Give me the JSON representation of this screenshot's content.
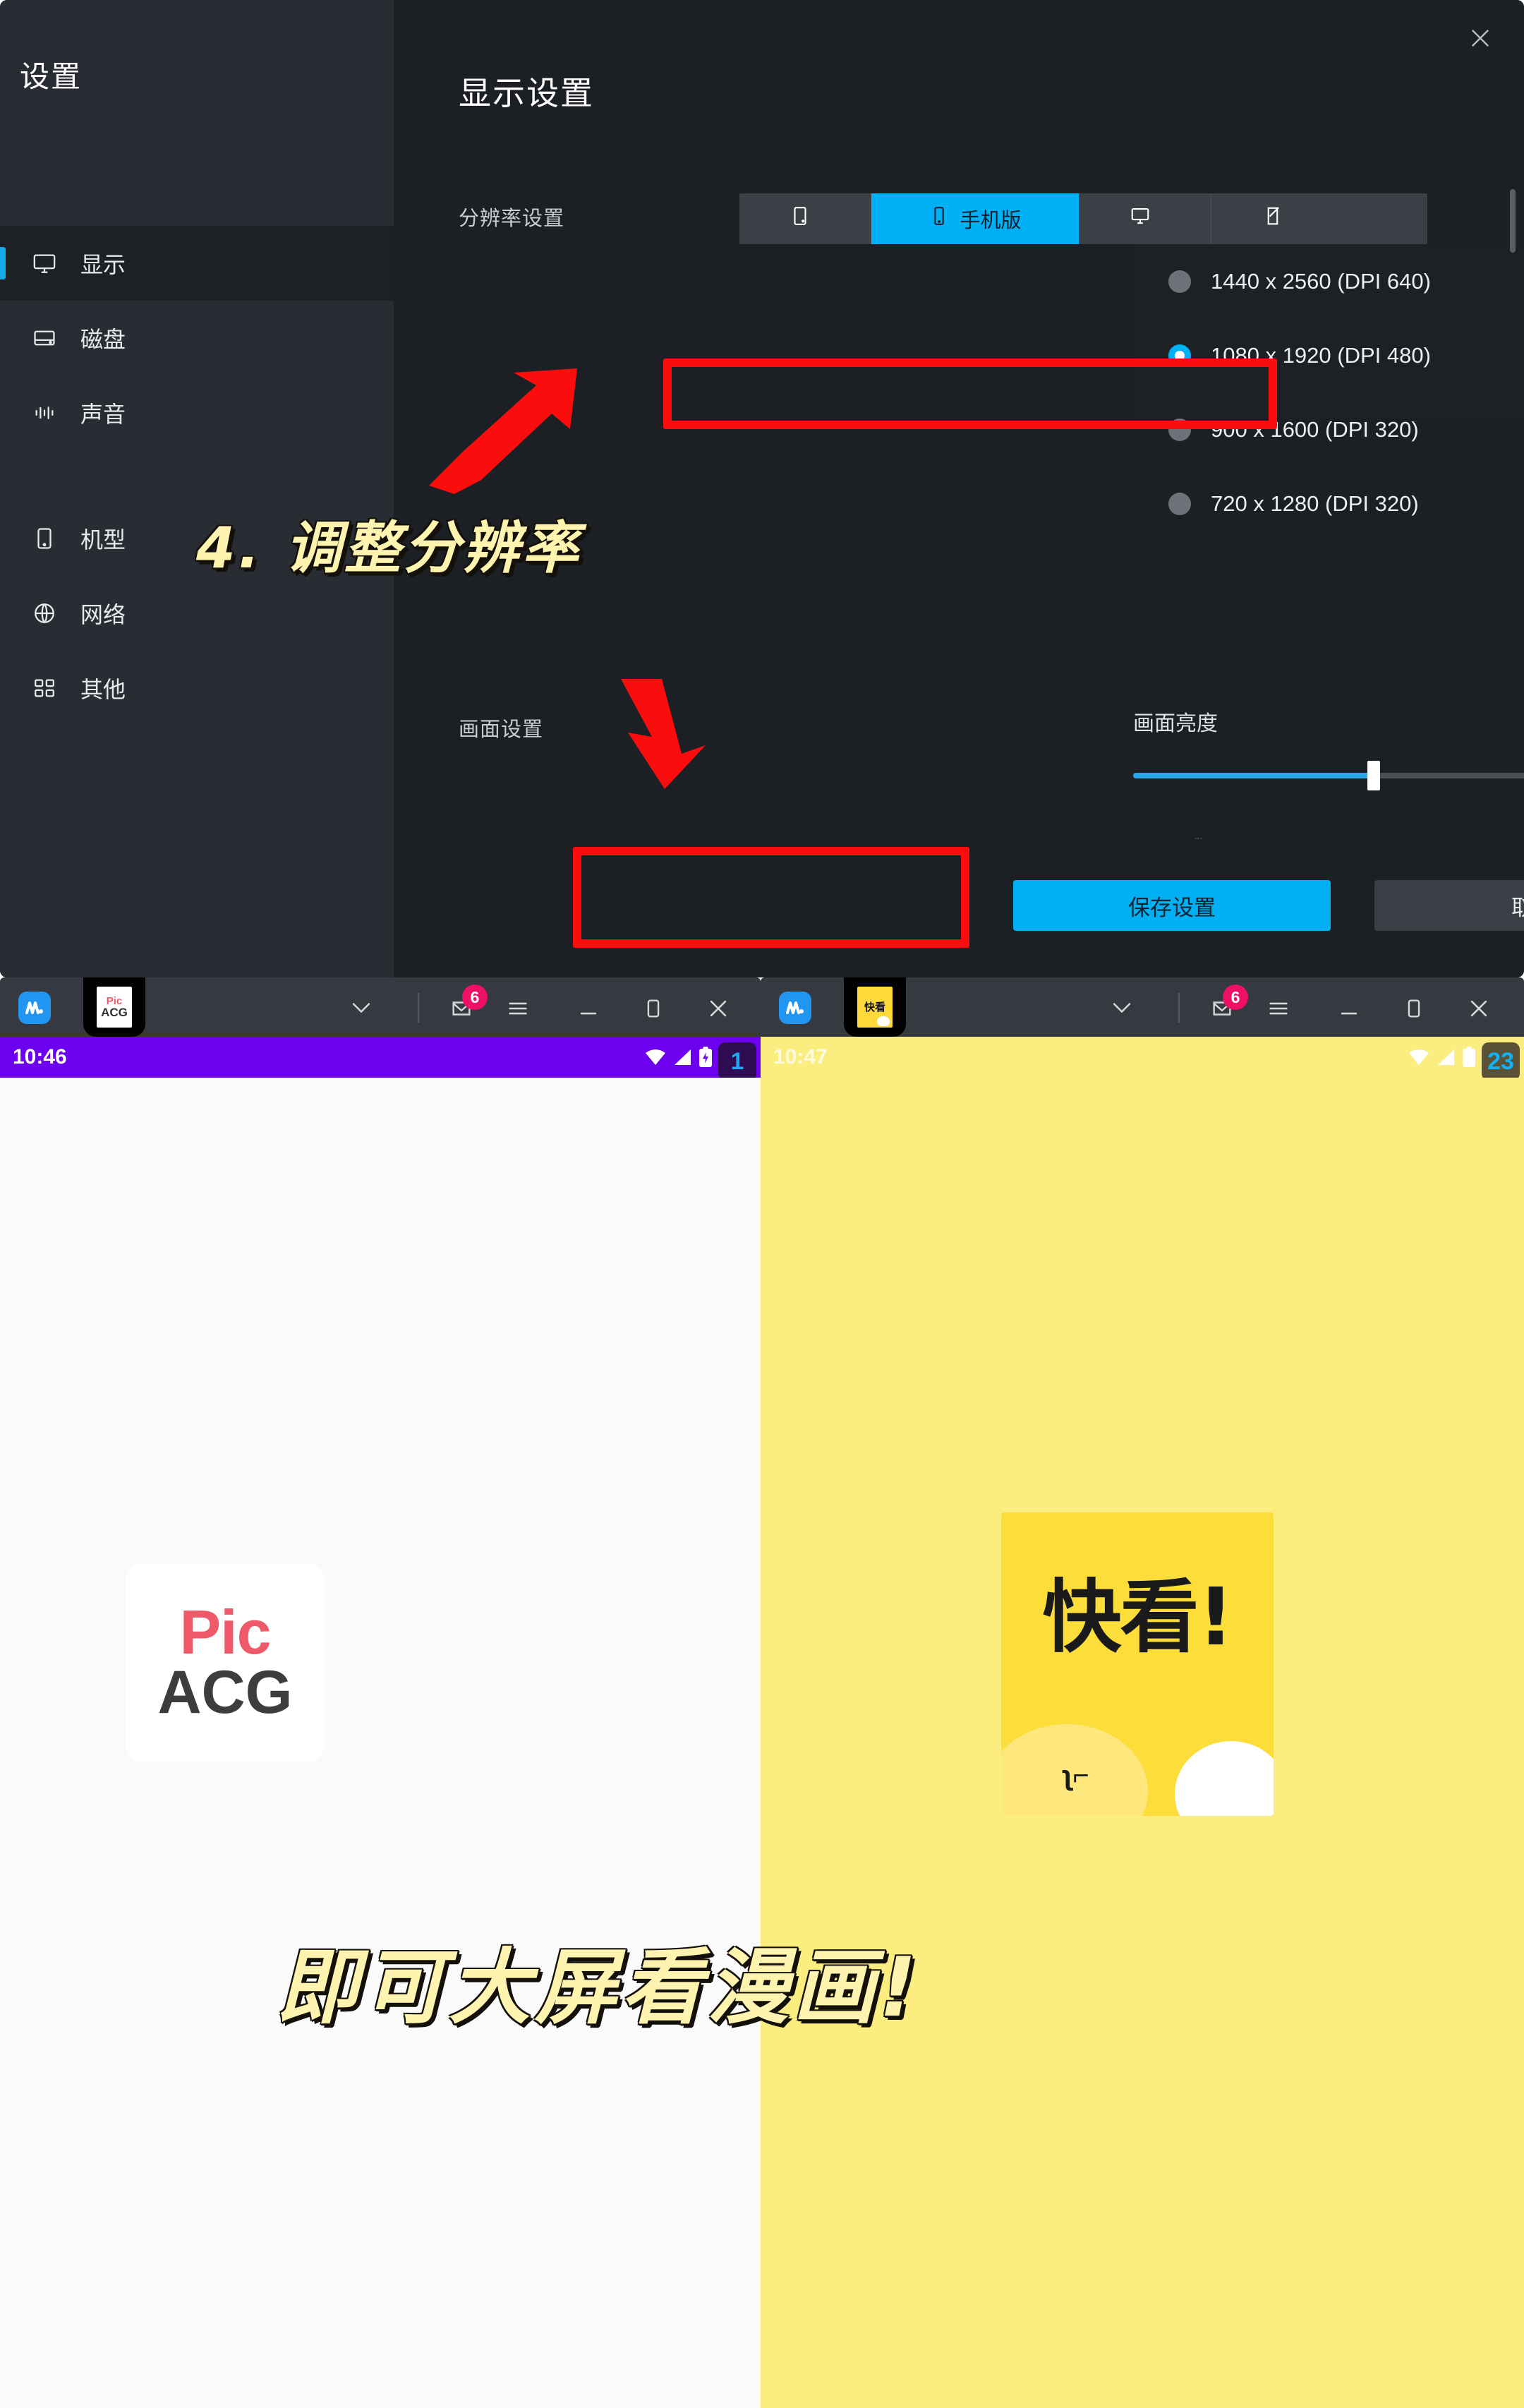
{
  "settings_window": {
    "sidebar": {
      "title": "设置",
      "items": [
        {
          "label": "显示",
          "icon": "monitor-icon",
          "active": true
        },
        {
          "label": "磁盘",
          "icon": "disk-icon",
          "active": false
        },
        {
          "label": "声音",
          "icon": "sound-icon",
          "active": false
        },
        {
          "label": "机型",
          "icon": "phone-icon",
          "active": false
        },
        {
          "label": "网络",
          "icon": "globe-icon",
          "active": false
        },
        {
          "label": "其他",
          "icon": "grid-icon",
          "active": false
        }
      ]
    },
    "panel": {
      "title": "显示设置",
      "close_icon": "close-icon",
      "resolution_label": "分辨率设置",
      "tabs": [
        {
          "label": "",
          "icon": "tablet-icon",
          "selected": false
        },
        {
          "label": "手机版",
          "icon": "phone-icon",
          "selected": true
        },
        {
          "label": "",
          "icon": "monitor-icon",
          "selected": false
        },
        {
          "label": "",
          "icon": "custom-edit-icon",
          "selected": false
        }
      ],
      "resolutions": [
        {
          "label": "1440 x 2560 (DPI 640)",
          "selected": false
        },
        {
          "label": "1080 x 1920 (DPI 480)",
          "selected": true
        },
        {
          "label": "900 x 1600 (DPI 320)",
          "selected": false
        },
        {
          "label": "720 x 1280 (DPI 320)",
          "selected": false
        }
      ],
      "screen_label": "画面设置",
      "brightness_label": "画面亮度",
      "brightness_value": "55",
      "save_label": "保存设置",
      "cancel_label": "取消",
      "accent_color": "#00b0f4"
    }
  },
  "annotations": {
    "step_text": "4. 调整分辨率",
    "caption_text": "即可大屏看漫画!",
    "highlight_color": "#fc0d0d",
    "text_color": "#fff3b0"
  },
  "emulators": [
    {
      "side": "left",
      "app_name": "PicACG",
      "tab_icon": "picacg-tab-thumbnail",
      "mail_badge": "6",
      "controls": [
        "chevron-down-icon",
        "mail-icon",
        "menu-icon",
        "minimize-icon",
        "maximize-icon",
        "close-icon"
      ],
      "status": {
        "time": "10:46",
        "icons": [
          "wifi-icon",
          "signal-icon",
          "battery-charging-icon"
        ],
        "count_badge": "1",
        "bar_color": "#6d00ef"
      },
      "logo": {
        "line1": "Pic",
        "line2": "ACG"
      },
      "body_color": "#fafafa"
    },
    {
      "side": "right",
      "app_name": "快看漫画",
      "tab_icon": "kuaikan-tab-thumbnail",
      "mail_badge": "6",
      "controls": [
        "chevron-down-icon",
        "mail-icon",
        "menu-icon",
        "minimize-icon",
        "maximize-icon",
        "close-icon"
      ],
      "status": {
        "time": "10:47",
        "icons": [
          "wifi-icon",
          "signal-icon",
          "battery-icon"
        ],
        "count_badge": "23",
        "bar_color": "#fced81"
      },
      "logo": {
        "line1": "快看!"
      },
      "body_color": "#fced81"
    }
  ]
}
